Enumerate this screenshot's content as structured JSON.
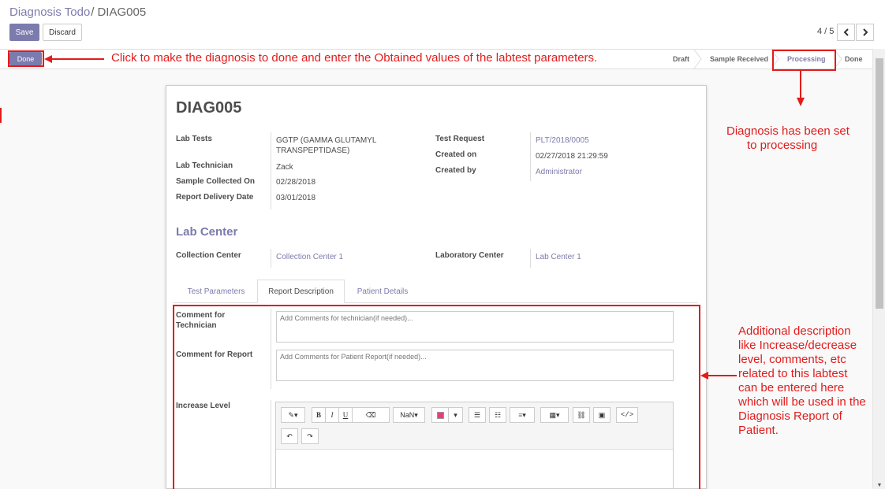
{
  "breadcrumb": {
    "parent": "Diagnosis Todo",
    "sep": "/",
    "current": "DIAG005"
  },
  "buttons": {
    "save": "Save",
    "discard": "Discard",
    "done": "Done"
  },
  "pager": {
    "value": "4 / 5"
  },
  "stages": {
    "draft": "Draft",
    "sample": "Sample Received",
    "processing": "Processing",
    "done": "Done"
  },
  "record": {
    "title": "DIAG005",
    "lab_tests_label": "Lab Tests",
    "lab_tests_value_1": "GGTP (GAMMA GLUTAMYL",
    "lab_tests_value_2": "TRANSPEPTIDASE)",
    "lab_technician_label": "Lab Technician",
    "lab_technician_value": "Zack",
    "sample_collected_label": "Sample Collected On",
    "sample_collected_value": "02/28/2018",
    "report_delivery_label": "Report Delivery Date",
    "report_delivery_value": "03/01/2018",
    "test_request_label": "Test Request",
    "test_request_value": "PLT/2018/0005",
    "created_on_label": "Created on",
    "created_on_value": "02/27/2018 21:29:59",
    "created_by_label": "Created by",
    "created_by_value": "Administrator"
  },
  "lab_center": {
    "title": "Lab Center",
    "collection_label": "Collection Center",
    "collection_value": "Collection Center 1",
    "laboratory_label": "Laboratory Center",
    "laboratory_value": "Lab Center 1"
  },
  "tabs": [
    "Test Parameters",
    "Report Description",
    "Patient Details"
  ],
  "report": {
    "comment_tech_label_1": "Comment for",
    "comment_tech_label_2": "Technician",
    "comment_tech_placeholder": "Add Comments for technician(if needed)...",
    "comment_report_label": "Comment for Report",
    "comment_report_placeholder": "Add Comments for Patient Report(if needed)...",
    "increase_label": "Increase Level"
  },
  "editor": {
    "font_size": "NaN"
  },
  "annotations": {
    "done": "Click to make the diagnosis to done and enter the Obtained values of the labtest parameters.",
    "processing_1": "Diagnosis has been set",
    "processing_2": "to processing",
    "description": [
      "Additional description",
      "like Increase/decrease",
      "level, comments, etc",
      "related to this labtest",
      "can be entered here",
      "which will be used in the",
      "Diagnosis Report of",
      "Patient."
    ]
  }
}
